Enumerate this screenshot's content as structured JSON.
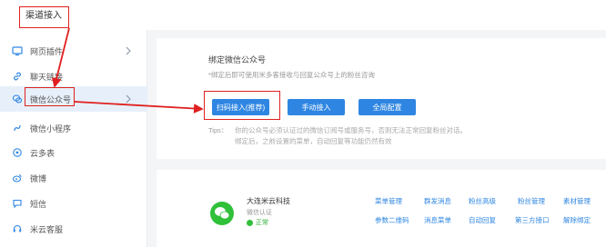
{
  "header": {
    "title": "渠道接入"
  },
  "sidebar": {
    "items": [
      {
        "label": "网页插件",
        "icon": "monitor-icon",
        "has_chevron": true
      },
      {
        "label": "聊天链接",
        "icon": "link-icon",
        "has_chevron": false
      },
      {
        "label": "微信公众号",
        "icon": "wechat-official-icon",
        "has_chevron": true
      },
      {
        "label": "微信小程序",
        "icon": "mini-program-icon",
        "has_chevron": false
      },
      {
        "label": "云多表",
        "icon": "cloud-icon",
        "has_chevron": false
      },
      {
        "label": "微博",
        "icon": "weibo-icon",
        "has_chevron": false
      },
      {
        "label": "短信",
        "icon": "sms-icon",
        "has_chevron": false
      },
      {
        "label": "米云客服",
        "icon": "headset-icon",
        "has_chevron": false
      }
    ],
    "active_index": 2
  },
  "bind_section": {
    "title": "绑定微信公众号",
    "note": "*绑定后即可使用米多客接收与回复公众号上的粉丝咨询",
    "buttons": {
      "scan": "扫码接入(推荐)",
      "manual": "手动接入",
      "global": "全局配置"
    },
    "tips_label": "Tips：",
    "tips_line1": "你的公众号必须认证过的微信订阅号或服务号，否则无法正常回复粉丝对话。",
    "tips_line2": "绑定后，之前设置的菜单，自动回复等功能仍然有效"
  },
  "account": {
    "name": "大连米云科技",
    "verification": "微信认证",
    "status": "正常",
    "actions_row1": [
      "菜单管理",
      "群发消息",
      "粉丝高级",
      "粉丝管理",
      "素材管理"
    ],
    "actions_row2": [
      "参数二维码",
      "消息菜单",
      "自动回复",
      "第三方接口",
      "解除绑定"
    ]
  },
  "colors": {
    "primary": "#2f86e2",
    "highlight": "#e02020",
    "active_bg": "#e7f0fa",
    "online": "#30c03a"
  }
}
